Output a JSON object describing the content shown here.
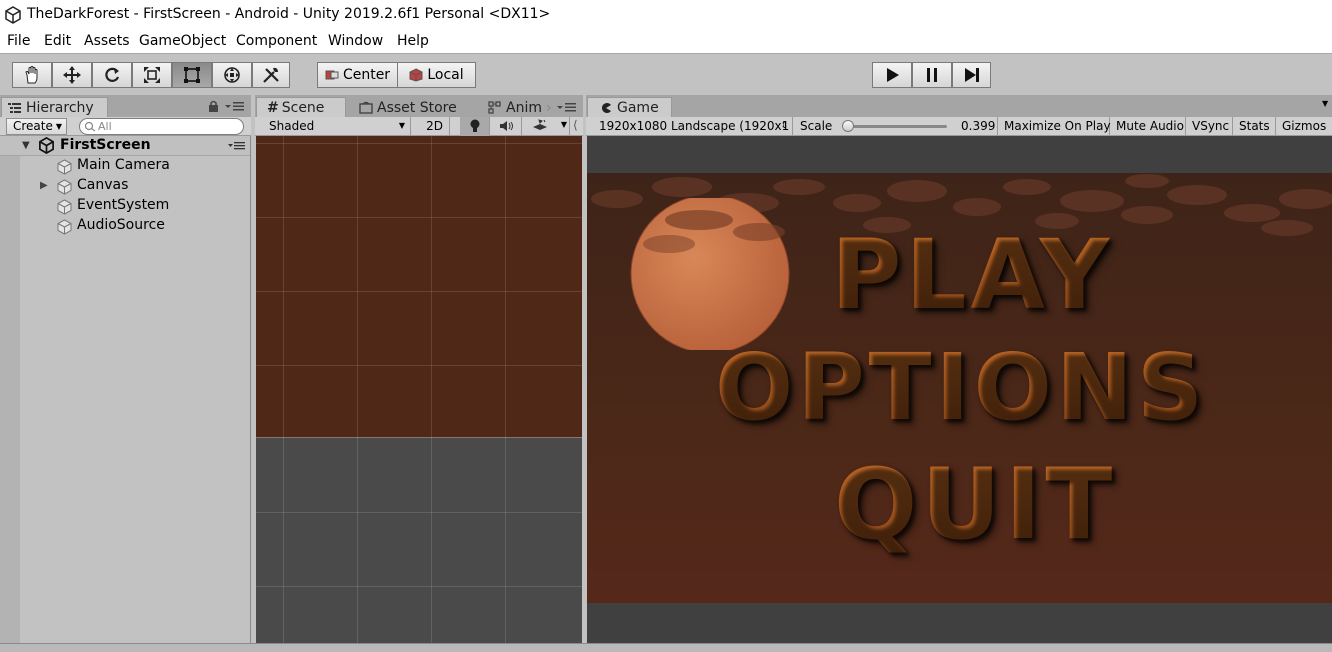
{
  "window": {
    "title": "TheDarkForest - FirstScreen - Android - Unity 2019.2.6f1 Personal <DX11>"
  },
  "menu": [
    "File",
    "Edit",
    "Assets",
    "GameObject",
    "Component",
    "Window",
    "Help"
  ],
  "toolbar": {
    "tools": [
      "hand-tool-icon",
      "move-tool-icon",
      "rotate-tool-icon",
      "scale-tool-icon",
      "rect-tool-icon",
      "transform-tool-icon",
      "custom-tool-icon"
    ],
    "active_tool": "rect-tool-icon",
    "pivot_label": "Center",
    "space_label": "Local",
    "play_controls": [
      "play-icon",
      "pause-icon",
      "step-icon"
    ]
  },
  "hierarchy": {
    "tab_label": "Hierarchy",
    "create_label": "Create",
    "search_placeholder": "All",
    "scene_name": "FirstScreen",
    "items": [
      {
        "label": "Main Camera",
        "expandable": false
      },
      {
        "label": "Canvas",
        "expandable": true
      },
      {
        "label": "EventSystem",
        "expandable": false
      },
      {
        "label": "AudioSource",
        "expandable": false
      }
    ]
  },
  "scene": {
    "tabs": [
      "Scene",
      "Asset Store",
      "Anim"
    ],
    "shading_mode": "Shaded",
    "mode_2d": "2D"
  },
  "game": {
    "tab_label": "Game",
    "resolution": "1920x1080 Landscape (1920x1",
    "scale_label": "Scale",
    "scale_value": "0.399",
    "scale_fraction": 0.0,
    "maximize_on_play": "Maximize On Play",
    "mute_audio": "Mute Audio",
    "vsync": "VSync",
    "stats": "Stats",
    "gizmos": "Gizmos",
    "menu_items": [
      "PLAY",
      "OPTIONS",
      "QUIT"
    ]
  },
  "colors": {
    "menu_text": "#a85c20",
    "game_bg": "#4c2818",
    "moon": "#c8744a"
  }
}
